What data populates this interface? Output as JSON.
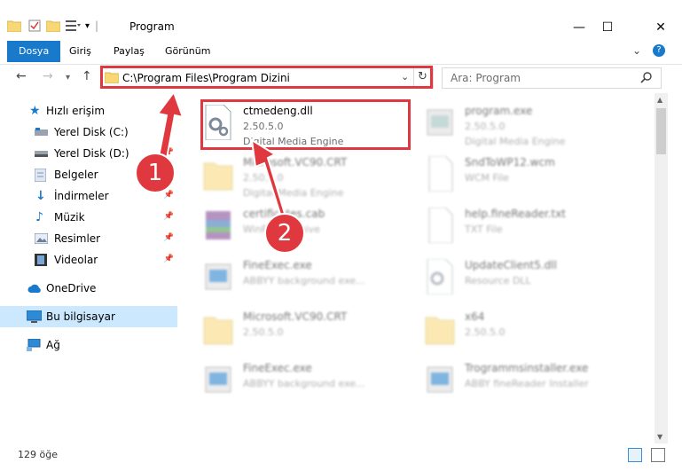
{
  "window": {
    "title": "Program"
  },
  "ribbon": {
    "tabs": [
      {
        "label": "Dosya",
        "active": true
      },
      {
        "label": "Giriş",
        "active": false
      },
      {
        "label": "Paylaş",
        "active": false
      },
      {
        "label": "Görünüm",
        "active": false
      }
    ]
  },
  "address": {
    "path": "C:\\Program Files\\Program Dizini"
  },
  "search": {
    "placeholder": "Ara: Program"
  },
  "sidebar": {
    "items": [
      {
        "label": "Hızlı erişim",
        "icon": "star-icon"
      },
      {
        "label": "Yerel Disk (C:)",
        "icon": "drive-icon",
        "pinned": true
      },
      {
        "label": "Yerel Disk (D:)",
        "icon": "drive-icon",
        "pinned": true
      },
      {
        "label": "Belgeler",
        "icon": "documents-icon",
        "pinned": true
      },
      {
        "label": "İndirmeler",
        "icon": "download-icon",
        "pinned": true
      },
      {
        "label": "Müzik",
        "icon": "music-icon",
        "pinned": true
      },
      {
        "label": "Resimler",
        "icon": "pictures-icon",
        "pinned": true
      },
      {
        "label": "Videolar",
        "icon": "video-icon",
        "pinned": true
      },
      {
        "label": "OneDrive",
        "icon": "cloud-icon"
      },
      {
        "label": "Bu bilgisayar",
        "icon": "computer-icon",
        "selected": true
      },
      {
        "label": "Ağ",
        "icon": "network-icon"
      }
    ]
  },
  "files": [
    {
      "name": "ctmedeng.dll",
      "line2": "2.50.5.0",
      "line3": "Digital Media Engine",
      "icon": "dll-icon",
      "highlighted": true
    },
    {
      "name": "program.exe",
      "line2": "2.50.5.0",
      "line3": "Digital Media Engine",
      "icon": "exe-icon"
    },
    {
      "name": "Microsoft.VC90.CRT",
      "line2": "2.50.5.0",
      "line3": "Digital Media Engine",
      "icon": "folder-icon"
    },
    {
      "name": "SndToWP12.wcm",
      "line2": "WCM File",
      "line3": "",
      "icon": "file-icon"
    },
    {
      "name": "certificates.cab",
      "line2": "WinRAR archive",
      "line3": "",
      "icon": "archive-icon"
    },
    {
      "name": "help.fineReader.txt",
      "line2": "TXT File",
      "line3": "",
      "icon": "file-icon"
    },
    {
      "name": "FineExec.exe",
      "line2": "ABBYY background exe...",
      "line3": "",
      "icon": "exe-icon"
    },
    {
      "name": "UpdateClient5.dll",
      "line2": "Resource DLL",
      "line3": "",
      "icon": "dll-icon"
    },
    {
      "name": "Microsoft.VC90.CRT",
      "line2": "2.50.5.0",
      "line3": "",
      "icon": "folder-icon"
    },
    {
      "name": "x64",
      "line2": "2.50.5.0",
      "line3": "",
      "icon": "folder-icon"
    },
    {
      "name": "FineExec.exe",
      "line2": "ABBYY background exe...",
      "line3": "",
      "icon": "exe-icon"
    },
    {
      "name": "Trogrammsinstaller.exe",
      "line2": "ABBY fineReader Installer",
      "line3": "",
      "icon": "exe-icon"
    }
  ],
  "status": {
    "count": "129 öğe"
  },
  "annotations": [
    {
      "label": "1"
    },
    {
      "label": "2"
    }
  ],
  "colors": {
    "accent": "#1979ca",
    "highlight": "#e0383f",
    "selected": "#cce8ff"
  }
}
